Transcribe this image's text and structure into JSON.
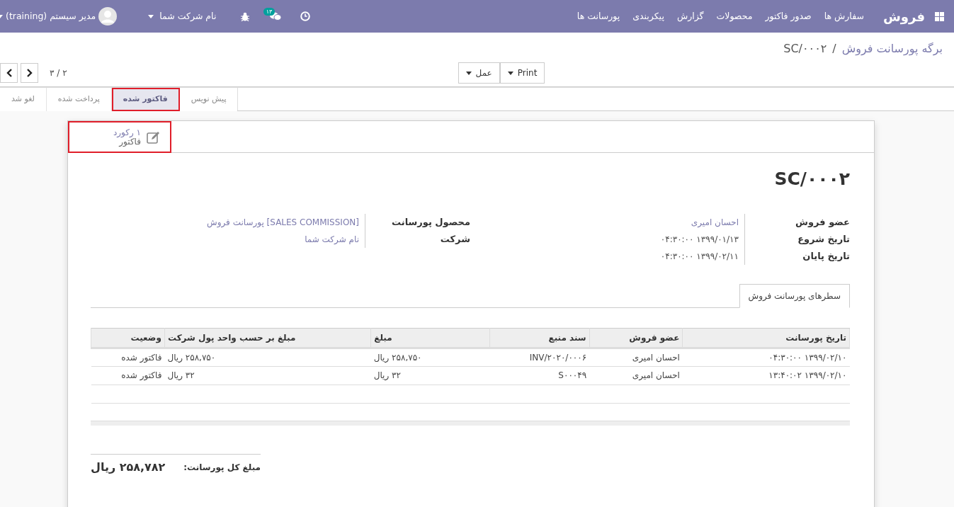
{
  "navbar": {
    "brand": "فروش",
    "menus": [
      "سفارش ها",
      "صدور فاکتور",
      "محصولات",
      "گزارش",
      "پیکربندی",
      "پورسانت ها"
    ],
    "chat_count": "۱۳",
    "company": "نام شرکت شما",
    "user": "مدیر سیستم (training)"
  },
  "breadcrumb": {
    "separator": "/",
    "items": [
      {
        "label": "برگه پورسانت فروش",
        "kind": "link"
      },
      {
        "label": "SC/۰۰۰۲",
        "kind": "current"
      }
    ]
  },
  "action_buttons": [
    "Print",
    "عمل"
  ],
  "pager": {
    "value": "۲ / ۳"
  },
  "statusbar": [
    {
      "label": "پیش نویس",
      "selected": false,
      "highlighted": false
    },
    {
      "label": "فاکتور شده",
      "selected": true,
      "highlighted": true
    },
    {
      "label": "پرداخت شده",
      "selected": false,
      "highlighted": false
    },
    {
      "label": "لغو شد",
      "selected": false,
      "highlighted": false
    }
  ],
  "smart_button": {
    "value": "۱ رکورد",
    "label": "فاکتور",
    "highlighted": true
  },
  "title": "SC/۰۰۰۲",
  "field_groups": [
    {
      "fields": [
        {
          "label": "عضو فروش",
          "value": "احسان امیری",
          "kind": "link"
        },
        {
          "label": "تاریخ شروع",
          "value": "۱۳۹۹/۰۱/۱۳ ۰۴:۳۰:۰۰",
          "kind": "text"
        },
        {
          "label": "تاریخ پایان",
          "value": "۱۳۹۹/۰۲/۱۱ ۰۴:۳۰:۰۰",
          "kind": "text"
        }
      ]
    },
    {
      "fields": [
        {
          "label": "محصول پورسانت",
          "value": "[SALES COMMISSION] پورسانت فروش",
          "kind": "link"
        },
        {
          "label": "شرکت",
          "value": "نام شرکت شما",
          "kind": "link"
        }
      ]
    }
  ],
  "tabs": [
    {
      "label": "سطرهای پورسانت فروش",
      "selected": true
    }
  ],
  "table": {
    "columns": [
      {
        "label": "تاریخ پورسانت",
        "kind": "text"
      },
      {
        "label": "عضو فروش",
        "kind": "text"
      },
      {
        "label": "سند منبع",
        "kind": "text"
      },
      {
        "label": "مبلغ",
        "kind": "monetary"
      },
      {
        "label": "مبلغ بر حسب واحد پول شرکت",
        "kind": "monetary"
      },
      {
        "label": "وضعیت",
        "kind": "text"
      }
    ],
    "rows": [
      [
        "۱۳۹۹/۰۲/۱۰ ۰۴:۳۰:۰۰",
        "احسان امیری",
        "INV/۲۰۲۰/۰۰۰۶",
        "۲۵۸,۷۵۰ ریال",
        "۲۵۸,۷۵۰ ریال",
        "فاکتور شده"
      ],
      [
        "۱۳۹۹/۰۲/۱۰ ۱۳:۴۰:۰۲",
        "احسان امیری",
        "S۰۰۰۴۹",
        "۳۲ ریال",
        "۳۲ ریال",
        "فاکتور شده"
      ]
    ]
  },
  "total": {
    "label": "مبلغ کل پورسانت:",
    "value": "۲۵۸,۷۸۲ ریال"
  }
}
